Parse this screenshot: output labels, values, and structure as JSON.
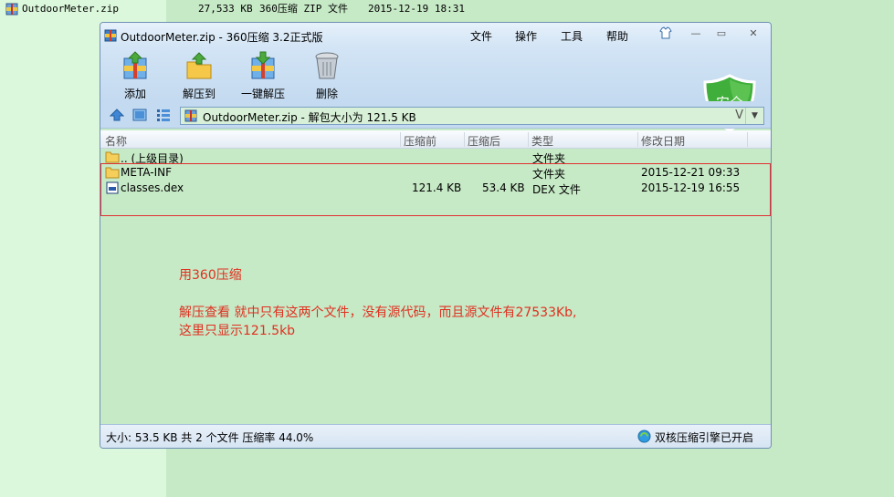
{
  "background_file": {
    "name": "OutdoorMeter.zip",
    "size": "27,533 KB",
    "type": "360压缩 ZIP 文件",
    "date": "2015-12-19 18:31"
  },
  "window": {
    "title": "OutdoorMeter.zip - 360压缩 3.2正式版",
    "menu": [
      "文件",
      "操作",
      "工具",
      "帮助"
    ],
    "toolbar": {
      "add": "添加",
      "extract_to": "解压到",
      "one_click_extract": "一键解压",
      "delete": "删除"
    },
    "security_badge": "安全",
    "address": "OutdoorMeter.zip - 解包大小为 121.5 KB",
    "address_suffix": "V",
    "columns": {
      "name": "名称",
      "before": "压缩前",
      "after": "压缩后",
      "type": "类型",
      "modified": "修改日期"
    },
    "files": [
      {
        "name": ".. (上级目录)",
        "before": "",
        "after": "",
        "type": "文件夹",
        "modified": ""
      },
      {
        "name": "META-INF",
        "before": "",
        "after": "",
        "type": "文件夹",
        "modified": "2015-12-21 09:33"
      },
      {
        "name": "classes.dex",
        "before": "121.4 KB",
        "after": "53.4 KB",
        "type": "DEX 文件",
        "modified": "2015-12-19 16:55"
      }
    ],
    "notes": [
      "用360压缩",
      "解压查看 就中只有这两个文件，没有源代码，而且源文件有27533Kb,",
      "这里只显示121.5kb"
    ],
    "status": {
      "summary": "大小: 53.5 KB 共 2 个文件 压缩率 44.0%",
      "engine": "双核压缩引擎已开启"
    }
  },
  "colors": {
    "background": "#c6e9c6",
    "left_strip": "#dcf8dc",
    "annotation_red": "#e03020",
    "titlebar": "#d2e4f5"
  }
}
